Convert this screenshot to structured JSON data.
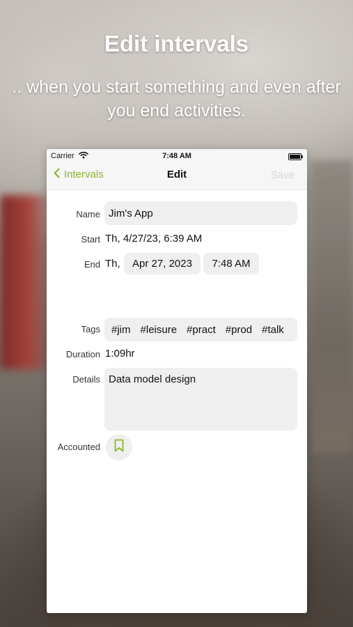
{
  "headline": {
    "title": "Edit intervals",
    "subtitle": ".. when you start something and even after you end activities."
  },
  "status_bar": {
    "carrier": "Carrier",
    "time": "7:48 AM"
  },
  "nav": {
    "back_label": "Intervals",
    "title": "Edit",
    "save_label": "Save"
  },
  "form": {
    "name_label": "Name",
    "name_value": "Jim's App",
    "start_label": "Start",
    "start_value": "Th,  4/27/23, 6:39 AM",
    "end_label": "End",
    "end_day": "Th,",
    "end_date": "Apr 27, 2023",
    "end_time": "7:48 AM",
    "tags_label": "Tags",
    "tags": [
      "#jim",
      "#leisure",
      "#pract",
      "#prod",
      "#talk"
    ],
    "duration_label": "Duration",
    "duration_value": "1:09hr",
    "details_label": "Details",
    "details_value": "Data model design",
    "accounted_label": "Accounted"
  },
  "colors": {
    "accent": "#8fb52a",
    "field_bg": "#efefef",
    "disabled": "#d6d6d6"
  },
  "icons": {
    "back": "chevron-left-icon",
    "wifi": "wifi-icon",
    "battery": "battery-icon",
    "accounted": "bookmark-icon"
  }
}
